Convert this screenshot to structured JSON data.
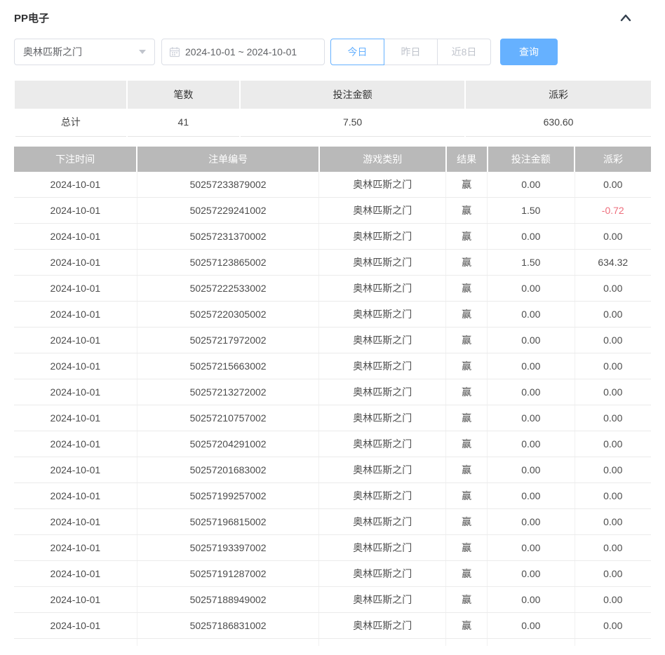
{
  "colors": {
    "accent_blue": "#66b1ff",
    "negative_red": "#ee6e7c"
  },
  "header": {
    "title": "PP电子",
    "collapse_icon": "chevron-up"
  },
  "filters": {
    "game_select": {
      "value": "奥林匹斯之门",
      "caret_icon": "caret-down"
    },
    "date_range": {
      "value": "2024-10-01 ~ 2024-10-01",
      "icon": "calendar"
    },
    "quick_buttons": [
      {
        "label": "今日",
        "active": true
      },
      {
        "label": "昨日",
        "active": false
      },
      {
        "label": "近8日",
        "active": false
      }
    ],
    "search_button": "查询"
  },
  "summary": {
    "columns": [
      "",
      "笔数",
      "投注金额",
      "派彩"
    ],
    "row_label": "总计",
    "count": "41",
    "bet_amount": "7.50",
    "payout": "630.60"
  },
  "table": {
    "columns": [
      "下注时间",
      "注单编号",
      "游戏类别",
      "结果",
      "投注金额",
      "派彩"
    ],
    "rows": [
      [
        "2024-10-01",
        "50257233879002",
        "奥林匹斯之门",
        "赢",
        "0.00",
        "0.00"
      ],
      [
        "2024-10-01",
        "50257229241002",
        "奥林匹斯之门",
        "赢",
        "1.50",
        "-0.72"
      ],
      [
        "2024-10-01",
        "50257231370002",
        "奥林匹斯之门",
        "赢",
        "0.00",
        "0.00"
      ],
      [
        "2024-10-01",
        "50257123865002",
        "奥林匹斯之门",
        "赢",
        "1.50",
        "634.32"
      ],
      [
        "2024-10-01",
        "50257222533002",
        "奥林匹斯之门",
        "赢",
        "0.00",
        "0.00"
      ],
      [
        "2024-10-01",
        "50257220305002",
        "奥林匹斯之门",
        "赢",
        "0.00",
        "0.00"
      ],
      [
        "2024-10-01",
        "50257217972002",
        "奥林匹斯之门",
        "赢",
        "0.00",
        "0.00"
      ],
      [
        "2024-10-01",
        "50257215663002",
        "奥林匹斯之门",
        "赢",
        "0.00",
        "0.00"
      ],
      [
        "2024-10-01",
        "50257213272002",
        "奥林匹斯之门",
        "赢",
        "0.00",
        "0.00"
      ],
      [
        "2024-10-01",
        "50257210757002",
        "奥林匹斯之门",
        "赢",
        "0.00",
        "0.00"
      ],
      [
        "2024-10-01",
        "50257204291002",
        "奥林匹斯之门",
        "赢",
        "0.00",
        "0.00"
      ],
      [
        "2024-10-01",
        "50257201683002",
        "奥林匹斯之门",
        "赢",
        "0.00",
        "0.00"
      ],
      [
        "2024-10-01",
        "50257199257002",
        "奥林匹斯之门",
        "赢",
        "0.00",
        "0.00"
      ],
      [
        "2024-10-01",
        "50257196815002",
        "奥林匹斯之门",
        "赢",
        "0.00",
        "0.00"
      ],
      [
        "2024-10-01",
        "50257193397002",
        "奥林匹斯之门",
        "赢",
        "0.00",
        "0.00"
      ],
      [
        "2024-10-01",
        "50257191287002",
        "奥林匹斯之门",
        "赢",
        "0.00",
        "0.00"
      ],
      [
        "2024-10-01",
        "50257188949002",
        "奥林匹斯之门",
        "赢",
        "0.00",
        "0.00"
      ],
      [
        "2024-10-01",
        "50257186831002",
        "奥林匹斯之门",
        "赢",
        "0.00",
        "0.00"
      ]
    ]
  }
}
